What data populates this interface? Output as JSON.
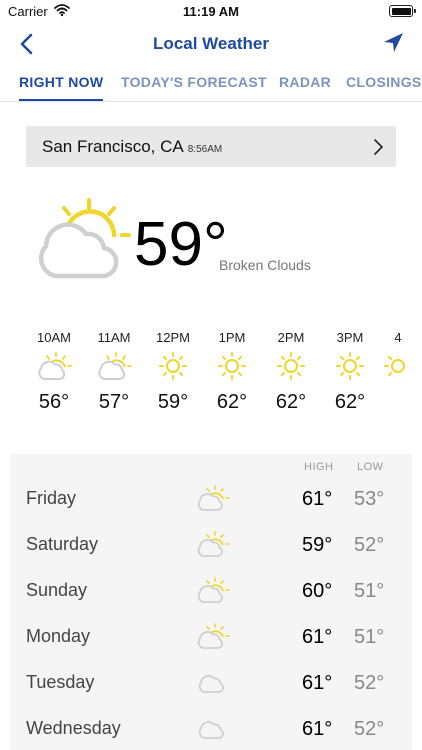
{
  "status_bar": {
    "carrier": "Carrier",
    "time": "11:19 AM"
  },
  "nav": {
    "title": "Local Weather",
    "back_icon": "chevron-left-icon",
    "location_icon": "location-arrow-icon"
  },
  "tabs": [
    {
      "label": "RIGHT NOW",
      "active": true
    },
    {
      "label": "TODAY'S FORECAST",
      "active": false
    },
    {
      "label": "RADAR",
      "active": false
    },
    {
      "label": "CLOSINGS",
      "active": false
    }
  ],
  "location": {
    "name": "San Francisco, CA",
    "time": "8:56AM"
  },
  "current": {
    "temp": "59°",
    "condition": "Broken Clouds",
    "icon": "partly-cloudy-icon"
  },
  "hourly": [
    {
      "time": "10AM",
      "temp": "56°",
      "icon": "partly-cloudy-icon"
    },
    {
      "time": "11AM",
      "temp": "57°",
      "icon": "partly-cloudy-icon"
    },
    {
      "time": "12PM",
      "temp": "59°",
      "icon": "sun-icon"
    },
    {
      "time": "1PM",
      "temp": "62°",
      "icon": "sun-icon"
    },
    {
      "time": "2PM",
      "temp": "62°",
      "icon": "sun-icon"
    },
    {
      "time": "3PM",
      "temp": "62°",
      "icon": "sun-icon"
    },
    {
      "time": "4",
      "temp": "",
      "icon": "sun-icon"
    }
  ],
  "daily": {
    "high_label": "HIGH",
    "low_label": "LOW",
    "days": [
      {
        "day": "Friday",
        "high": "61°",
        "low": "53°",
        "icon": "partly-cloudy-icon"
      },
      {
        "day": "Saturday",
        "high": "59°",
        "low": "52°",
        "icon": "partly-cloudy-icon"
      },
      {
        "day": "Sunday",
        "high": "60°",
        "low": "51°",
        "icon": "partly-cloudy-icon"
      },
      {
        "day": "Monday",
        "high": "61°",
        "low": "51°",
        "icon": "partly-cloudy-icon"
      },
      {
        "day": "Tuesday",
        "high": "61°",
        "low": "52°",
        "icon": "cloud-icon"
      },
      {
        "day": "Wednesday",
        "high": "61°",
        "low": "52°",
        "icon": "cloud-icon"
      }
    ]
  },
  "colors": {
    "accent": "#1f4aa0",
    "tab_inactive": "#7c93bf",
    "sun": "#f2d52b",
    "cloud": "#cfcfcf"
  }
}
